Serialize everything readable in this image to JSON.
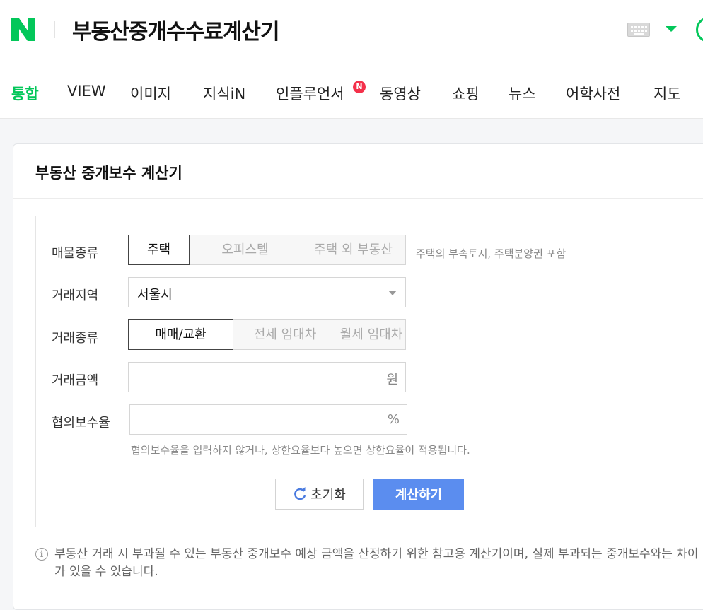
{
  "header": {
    "logo_text": "N",
    "search_query": "부동산중개수수료계산기",
    "accent_color": "#03c75a"
  },
  "nav": {
    "tabs": [
      {
        "label": "통합",
        "active": true
      },
      {
        "label": "VIEW",
        "active": false
      },
      {
        "label": "이미지",
        "active": false
      },
      {
        "label": "지식iN",
        "active": false
      },
      {
        "label": "인플루언서",
        "active": false,
        "badge": "N"
      },
      {
        "label": "동영상",
        "active": false
      },
      {
        "label": "쇼핑",
        "active": false
      },
      {
        "label": "뉴스",
        "active": false
      },
      {
        "label": "어학사전",
        "active": false
      },
      {
        "label": "지도",
        "active": false
      }
    ]
  },
  "calculator": {
    "title": "부동산 중개보수 계산기",
    "property_type": {
      "label": "매물종류",
      "options": [
        "주택",
        "오피스텔",
        "주택 외 부동산"
      ],
      "selected": "주택",
      "hint": "주택의 부속토지, 주택분양권 포함"
    },
    "region": {
      "label": "거래지역",
      "value": "서울시"
    },
    "deal_type": {
      "label": "거래종류",
      "options": [
        "매매/교환",
        "전세 임대차",
        "월세 임대차"
      ],
      "selected": "매매/교환"
    },
    "amount": {
      "label": "거래금액",
      "unit": "원"
    },
    "rate": {
      "label": "협의보수율",
      "unit": "%",
      "hint": "협의보수율을 입력하지 않거나, 상한요율보다 높으면 상한요율이 적용됩니다."
    },
    "buttons": {
      "reset": "초기화",
      "calculate": "계산하기"
    },
    "notice": "부동산 거래 시 부과될 수 있는 부동산 중개보수 예상 금액을 산정하기 위한 참고용 계산기이며, 실제 부과되는 중개보수와는 차이가 있을 수 있습니다."
  }
}
